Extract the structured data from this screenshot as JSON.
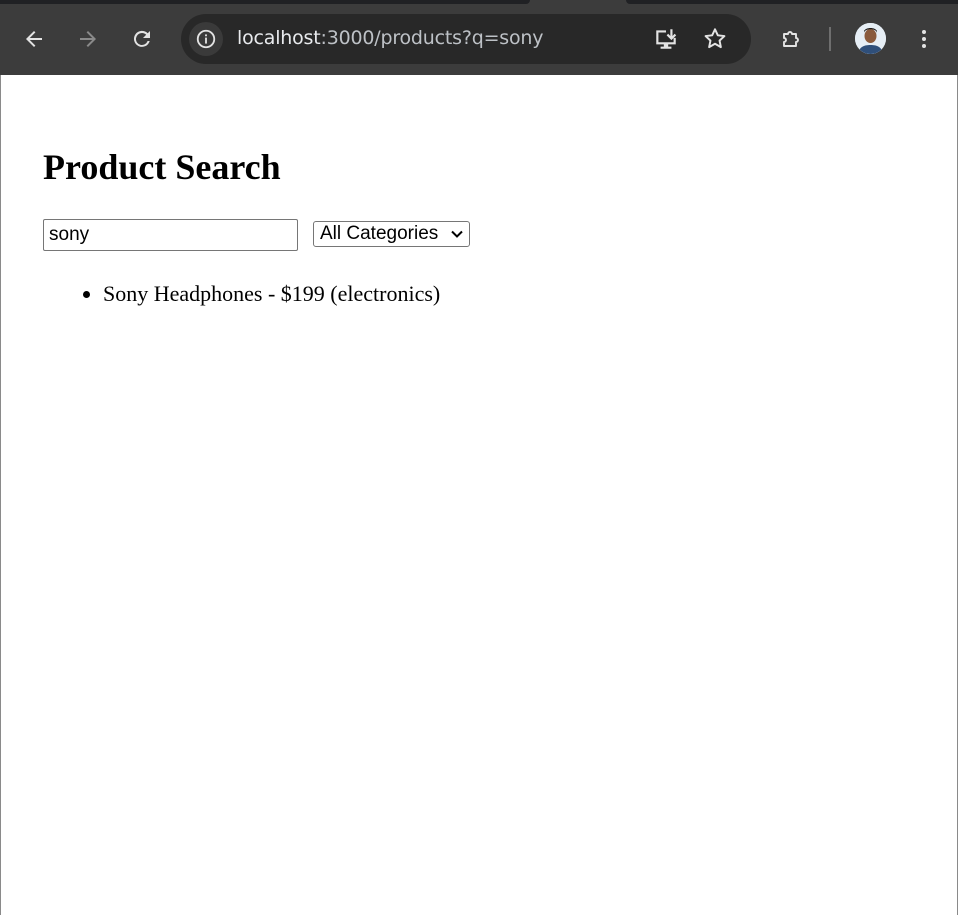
{
  "browser": {
    "url_host": "localhost",
    "url_rest": ":3000/products?q=sony"
  },
  "page": {
    "title": "Product Search",
    "search": {
      "value": "sony"
    },
    "category_select": {
      "selected": "All Categories"
    },
    "results": [
      "Sony Headphones - $199 (electronics)"
    ]
  },
  "icons": {
    "back": "arrow-left-icon",
    "forward": "arrow-right-icon",
    "reload": "reload-icon",
    "site_info": "info-icon",
    "install": "install-app-icon",
    "bookmark": "star-icon",
    "extensions": "puzzle-icon",
    "menu": "kebab-menu-icon"
  },
  "colors": {
    "chrome_bg": "#3c3c3c",
    "omnibox_bg": "#282828",
    "page_bg": "#ffffff"
  }
}
